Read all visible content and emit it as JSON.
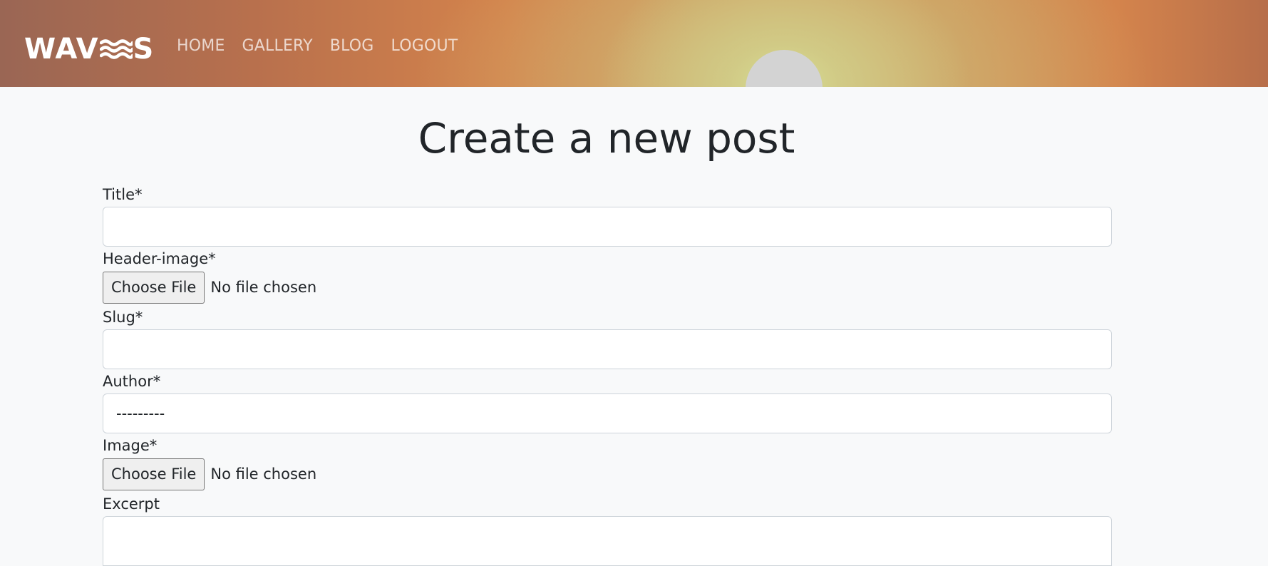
{
  "brand": {
    "logo_text_left": "WAV",
    "logo_text_right": "S",
    "logo_icon": "waves-icon"
  },
  "nav": {
    "items": [
      "HOME",
      "GALLERY",
      "BLOG",
      "LOGOUT"
    ]
  },
  "page": {
    "title": "Create a new post"
  },
  "form": {
    "title_label": "Title*",
    "title_value": "",
    "header_image_label": "Header-image*",
    "header_image_button": "Choose File",
    "header_image_status": "No file chosen",
    "slug_label": "Slug*",
    "slug_value": "",
    "author_label": "Author*",
    "author_selected": "---------",
    "image_label": "Image*",
    "image_button": "Choose File",
    "image_status": "No file chosen",
    "excerpt_label": "Excerpt",
    "excerpt_value": ""
  },
  "colors": {
    "page_background": "#f8f9fa",
    "nav_link": "#f3ddd0",
    "text": "#212529",
    "field_border": "#ced4da"
  }
}
